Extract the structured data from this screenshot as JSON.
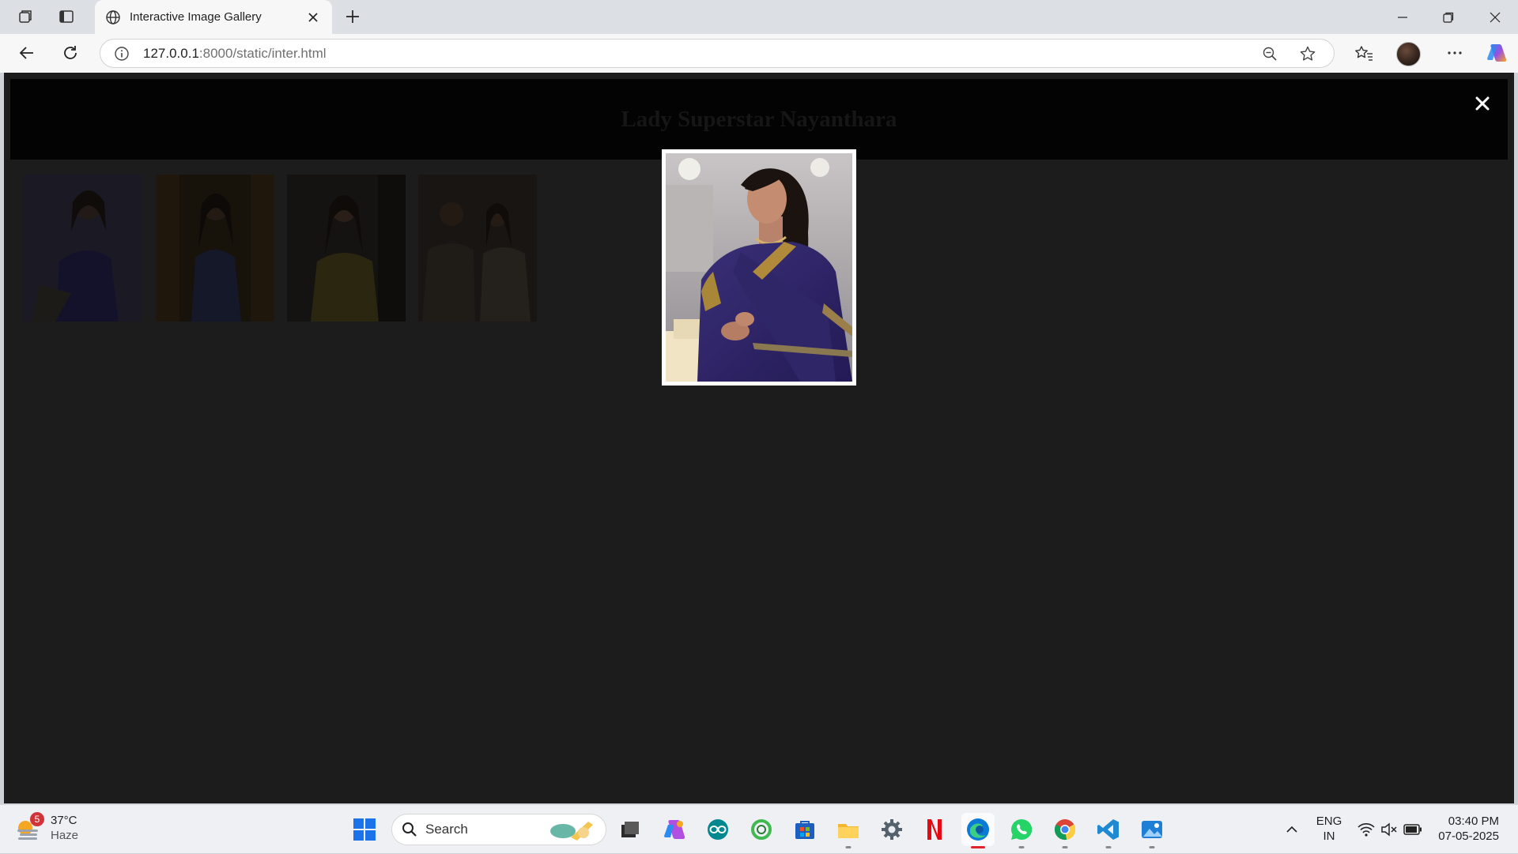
{
  "browser": {
    "tab_title": "Interactive Image Gallery",
    "url_host": "127.0.0.1",
    "url_rest": ":8000/static/inter.html"
  },
  "page": {
    "heading": "Lady Superstar Nayanthara",
    "close_symbol": "✕"
  },
  "taskbar": {
    "weather_badge": "5",
    "weather_temp": "37°C",
    "weather_condition": "Haze",
    "search_label": "Search",
    "lang_line1": "ENG",
    "lang_line2": "IN",
    "time": "03:40 PM",
    "date": "07-05-2025"
  },
  "colors": {
    "viewport_bg": "#1c1c1c",
    "header_bg": "#030303",
    "accent_edge": "#e0242b"
  },
  "icons": [
    "workspaces-icon",
    "tab-actions-icon",
    "globe-icon",
    "close-icon",
    "plus-icon",
    "minimize-icon",
    "restore-icon",
    "window-close-icon",
    "back-icon",
    "refresh-icon",
    "info-icon",
    "zoom-out-icon",
    "star-icon",
    "favorites-icon",
    "more-icon",
    "copilot-icon",
    "windows-start-icon",
    "search-icon",
    "edge-icon",
    "whatsapp-icon",
    "chrome-icon",
    "vscode-icon",
    "netflix-icon",
    "settings-icon",
    "files-icon",
    "store-icon",
    "wifi-icon",
    "volume-muted-icon",
    "battery-icon"
  ]
}
